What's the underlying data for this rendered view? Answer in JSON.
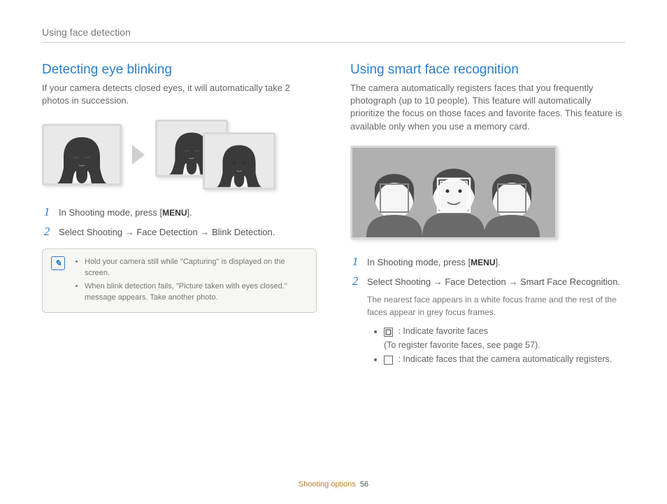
{
  "header": "Using face detection",
  "left": {
    "heading": "Detecting eye blinking",
    "intro": "If your camera detects closed eyes, it will automatically take 2 photos in succession.",
    "step1_a": "In Shooting mode, press [",
    "menu_label": "MENU",
    "step1_b": "].",
    "step2_a": "Select ",
    "step2_b1": "Shooting",
    "step2_arrow": " → ",
    "step2_b2": "Face Detection",
    "step2_b3": "Blink Detection",
    "step2_c": ".",
    "note1_a": "Hold your camera still while \"",
    "note1_b": "Capturing",
    "note1_c": "\" is displayed on the screen.",
    "note2_a": "When blink detection fails, \"",
    "note2_b": "Picture taken with eyes closed",
    "note2_c": ".\" message appears. Take another photo."
  },
  "right": {
    "heading": "Using smart face recognition",
    "intro": "The camera automatically registers faces that you frequently photograph (up to 10 people). This feature will automatically prioritize the focus on those faces and favorite faces. This feature is available only when you use a memory card.",
    "step1_a": "In Shooting mode, press [",
    "menu_label": "MENU",
    "step1_b": "].",
    "step2_a": "Select ",
    "step2_b1": "Shooting",
    "step2_arrow": " → ",
    "step2_b2": "Face Detection",
    "step2_b3": "Smart Face Recognition",
    "step2_c": ".",
    "subnote": "The nearest face appears in a white focus frame and the rest of the faces appear in grey focus frames.",
    "bullet1_a": " : Indicate favorite faces",
    "bullet1_b": "(To register favorite faces, see page 57).",
    "bullet2": " : Indicate faces that the camera automatically registers."
  },
  "footer": {
    "section": "Shooting options",
    "page": "56"
  }
}
